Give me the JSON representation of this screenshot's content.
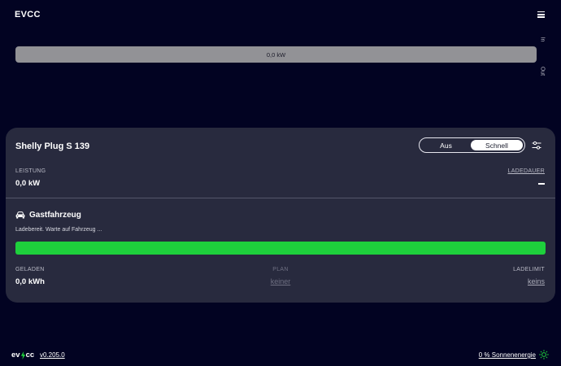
{
  "header": {
    "title": "EVCC"
  },
  "energy": {
    "bar_label": "0,0 kW",
    "in_label": "In",
    "out_label": "Out"
  },
  "loadpoint": {
    "title": "Shelly Plug S 139",
    "modes": [
      {
        "label": "Aus",
        "active": false
      },
      {
        "label": "Schnell",
        "active": true
      }
    ],
    "power": {
      "label": "LEISTUNG",
      "value": "0,0 kW"
    },
    "duration": {
      "label": "LADEDAUER"
    },
    "vehicle": {
      "name": "Gastfahrzeug",
      "icon": "car-icon",
      "status": "Ladebereit. Warte auf Fahrzeug ...",
      "progress_fraction": 1.0,
      "progress_color": "#1ed03c"
    },
    "charged": {
      "label": "GELADEN",
      "value": "0,0 kWh"
    },
    "plan": {
      "label": "PLAN",
      "value": "keiner"
    },
    "limit": {
      "label": "LADELIMIT",
      "value": "keins"
    }
  },
  "footer": {
    "logo_left": "ev",
    "logo_right": "cc",
    "version": "v0.205.0",
    "solar": "0 % Sonnenenergie"
  },
  "colors": {
    "background": "#020322",
    "card": "#282a3e",
    "accent_green": "#1ed03c",
    "energy_bar": "#929296"
  }
}
